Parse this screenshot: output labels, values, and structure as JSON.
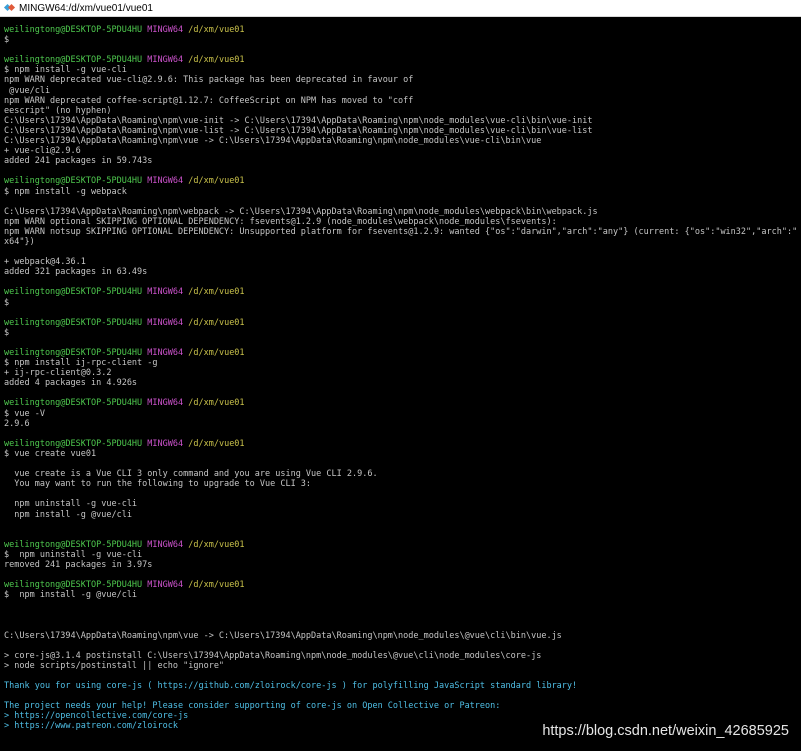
{
  "window": {
    "title": "MINGW64:/d/xm/vue01/vue01",
    "icon": "mingw-diamond-icon"
  },
  "terminal": {
    "colors": {
      "user": "#4ec94e",
      "host": "#cb52cb",
      "path": "#c8c04a",
      "text": "#c6c6c6",
      "link": "#4fbfe6"
    },
    "lines": [
      {
        "segs": [
          {
            "t": "weilingtong@DESKTOP-5PDU4HU",
            "c": "green"
          },
          {
            "t": " "
          },
          {
            "t": "MINGW64",
            "c": "magenta"
          },
          {
            "t": " "
          },
          {
            "t": "/d/xm/vue01",
            "c": "yellow"
          }
        ]
      },
      {
        "segs": [
          {
            "t": "$"
          }
        ]
      },
      {
        "segs": [
          {
            "t": ""
          }
        ]
      },
      {
        "segs": [
          {
            "t": "weilingtong@DESKTOP-5PDU4HU",
            "c": "green"
          },
          {
            "t": " "
          },
          {
            "t": "MINGW64",
            "c": "magenta"
          },
          {
            "t": " "
          },
          {
            "t": "/d/xm/vue01",
            "c": "yellow"
          }
        ]
      },
      {
        "segs": [
          {
            "t": "$ npm install -g vue-cli"
          }
        ]
      },
      {
        "segs": [
          {
            "t": "npm WARN deprecated vue-cli@2.9.6: This package has been deprecated in favour of"
          }
        ]
      },
      {
        "segs": [
          {
            "t": " @vue/cli"
          }
        ]
      },
      {
        "segs": [
          {
            "t": "npm WARN deprecated coffee-script@1.12.7: CoffeeScript on NPM has moved to \"coff"
          }
        ]
      },
      {
        "segs": [
          {
            "t": "eescript\" (no hyphen)"
          }
        ]
      },
      {
        "segs": [
          {
            "t": "C:\\Users\\17394\\AppData\\Roaming\\npm\\vue-init -> C:\\Users\\17394\\AppData\\Roaming\\npm\\node_modules\\vue-cli\\bin\\vue-init"
          }
        ]
      },
      {
        "segs": [
          {
            "t": "C:\\Users\\17394\\AppData\\Roaming\\npm\\vue-list -> C:\\Users\\17394\\AppData\\Roaming\\npm\\node_modules\\vue-cli\\bin\\vue-list"
          }
        ]
      },
      {
        "segs": [
          {
            "t": "C:\\Users\\17394\\AppData\\Roaming\\npm\\vue -> C:\\Users\\17394\\AppData\\Roaming\\npm\\node_modules\\vue-cli\\bin\\vue"
          }
        ]
      },
      {
        "segs": [
          {
            "t": "+ vue-cli@2.9.6"
          }
        ]
      },
      {
        "segs": [
          {
            "t": "added 241 packages in 59.743s"
          }
        ]
      },
      {
        "segs": [
          {
            "t": ""
          }
        ]
      },
      {
        "segs": [
          {
            "t": "weilingtong@DESKTOP-5PDU4HU",
            "c": "green"
          },
          {
            "t": " "
          },
          {
            "t": "MINGW64",
            "c": "magenta"
          },
          {
            "t": " "
          },
          {
            "t": "/d/xm/vue01",
            "c": "yellow"
          }
        ]
      },
      {
        "segs": [
          {
            "t": "$ npm install -g webpack"
          }
        ]
      },
      {
        "segs": [
          {
            "t": ""
          }
        ]
      },
      {
        "segs": [
          {
            "t": "C:\\Users\\17394\\AppData\\Roaming\\npm\\webpack -> C:\\Users\\17394\\AppData\\Roaming\\npm\\node_modules\\webpack\\bin\\webpack.js"
          }
        ]
      },
      {
        "segs": [
          {
            "t": "npm WARN optional SKIPPING OPTIONAL DEPENDENCY: fsevents@1.2.9 (node_modules\\webpack\\node_modules\\fsevents):"
          }
        ]
      },
      {
        "segs": [
          {
            "t": "npm WARN notsup SKIPPING OPTIONAL DEPENDENCY: Unsupported platform for fsevents@1.2.9: wanted {\"os\":\"darwin\",\"arch\":\"any\"} (current: {\"os\":\"win32\",\"arch\":\""
          }
        ]
      },
      {
        "segs": [
          {
            "t": "x64\"})"
          }
        ]
      },
      {
        "segs": [
          {
            "t": ""
          }
        ]
      },
      {
        "segs": [
          {
            "t": "+ webpack@4.36.1"
          }
        ]
      },
      {
        "segs": [
          {
            "t": "added 321 packages in 63.49s"
          }
        ]
      },
      {
        "segs": [
          {
            "t": ""
          }
        ]
      },
      {
        "segs": [
          {
            "t": "weilingtong@DESKTOP-5PDU4HU",
            "c": "green"
          },
          {
            "t": " "
          },
          {
            "t": "MINGW64",
            "c": "magenta"
          },
          {
            "t": " "
          },
          {
            "t": "/d/xm/vue01",
            "c": "yellow"
          }
        ]
      },
      {
        "segs": [
          {
            "t": "$"
          }
        ]
      },
      {
        "segs": [
          {
            "t": ""
          }
        ]
      },
      {
        "segs": [
          {
            "t": "weilingtong@DESKTOP-5PDU4HU",
            "c": "green"
          },
          {
            "t": " "
          },
          {
            "t": "MINGW64",
            "c": "magenta"
          },
          {
            "t": " "
          },
          {
            "t": "/d/xm/vue01",
            "c": "yellow"
          }
        ]
      },
      {
        "segs": [
          {
            "t": "$"
          }
        ]
      },
      {
        "segs": [
          {
            "t": ""
          }
        ]
      },
      {
        "segs": [
          {
            "t": "weilingtong@DESKTOP-5PDU4HU",
            "c": "green"
          },
          {
            "t": " "
          },
          {
            "t": "MINGW64",
            "c": "magenta"
          },
          {
            "t": " "
          },
          {
            "t": "/d/xm/vue01",
            "c": "yellow"
          }
        ]
      },
      {
        "segs": [
          {
            "t": "$ npm install ij-rpc-client -g"
          }
        ]
      },
      {
        "segs": [
          {
            "t": "+ ij-rpc-client@0.3.2"
          }
        ]
      },
      {
        "segs": [
          {
            "t": "added 4 packages in 4.926s"
          }
        ]
      },
      {
        "segs": [
          {
            "t": ""
          }
        ]
      },
      {
        "segs": [
          {
            "t": "weilingtong@DESKTOP-5PDU4HU",
            "c": "green"
          },
          {
            "t": " "
          },
          {
            "t": "MINGW64",
            "c": "magenta"
          },
          {
            "t": " "
          },
          {
            "t": "/d/xm/vue01",
            "c": "yellow"
          }
        ]
      },
      {
        "segs": [
          {
            "t": "$ vue -V"
          }
        ]
      },
      {
        "segs": [
          {
            "t": "2.9.6"
          }
        ]
      },
      {
        "segs": [
          {
            "t": ""
          }
        ]
      },
      {
        "segs": [
          {
            "t": "weilingtong@DESKTOP-5PDU4HU",
            "c": "green"
          },
          {
            "t": " "
          },
          {
            "t": "MINGW64",
            "c": "magenta"
          },
          {
            "t": " "
          },
          {
            "t": "/d/xm/vue01",
            "c": "yellow"
          }
        ]
      },
      {
        "segs": [
          {
            "t": "$ vue create vue01"
          }
        ]
      },
      {
        "segs": [
          {
            "t": ""
          }
        ]
      },
      {
        "segs": [
          {
            "t": "  vue create is a Vue CLI 3 only command and you are using Vue CLI 2.9.6."
          }
        ]
      },
      {
        "segs": [
          {
            "t": "  You may want to run the following to upgrade to Vue CLI 3:"
          }
        ]
      },
      {
        "segs": [
          {
            "t": ""
          }
        ]
      },
      {
        "segs": [
          {
            "t": "  npm uninstall -g vue-cli"
          }
        ]
      },
      {
        "segs": [
          {
            "t": "  npm install -g @vue/cli"
          }
        ]
      },
      {
        "segs": [
          {
            "t": ""
          }
        ]
      },
      {
        "segs": [
          {
            "t": ""
          }
        ]
      },
      {
        "segs": [
          {
            "t": "weilingtong@DESKTOP-5PDU4HU",
            "c": "green"
          },
          {
            "t": " "
          },
          {
            "t": "MINGW64",
            "c": "magenta"
          },
          {
            "t": " "
          },
          {
            "t": "/d/xm/vue01",
            "c": "yellow"
          }
        ]
      },
      {
        "segs": [
          {
            "t": "$  npm uninstall -g vue-cli"
          }
        ]
      },
      {
        "segs": [
          {
            "t": "removed 241 packages in 3.97s"
          }
        ]
      },
      {
        "segs": [
          {
            "t": ""
          }
        ]
      },
      {
        "segs": [
          {
            "t": "weilingtong@DESKTOP-5PDU4HU",
            "c": "green"
          },
          {
            "t": " "
          },
          {
            "t": "MINGW64",
            "c": "magenta"
          },
          {
            "t": " "
          },
          {
            "t": "/d/xm/vue01",
            "c": "yellow"
          }
        ]
      },
      {
        "segs": [
          {
            "t": "$  npm install -g @vue/cli"
          }
        ]
      },
      {
        "segs": [
          {
            "t": ""
          }
        ]
      },
      {
        "segs": [
          {
            "t": ""
          }
        ]
      },
      {
        "segs": [
          {
            "t": ""
          }
        ]
      },
      {
        "segs": [
          {
            "t": "C:\\Users\\17394\\AppData\\Roaming\\npm\\vue -> C:\\Users\\17394\\AppData\\Roaming\\npm\\node_modules\\@vue\\cli\\bin\\vue.js"
          }
        ]
      },
      {
        "segs": [
          {
            "t": ""
          }
        ]
      },
      {
        "segs": [
          {
            "t": "> core-js@3.1.4 postinstall C:\\Users\\17394\\AppData\\Roaming\\npm\\node_modules\\@vue\\cli\\node_modules\\core-js"
          }
        ]
      },
      {
        "segs": [
          {
            "t": "> node scripts/postinstall || echo \"ignore\""
          }
        ]
      },
      {
        "segs": [
          {
            "t": ""
          }
        ]
      },
      {
        "segs": [
          {
            "t": "Thank you for using core-js ( https://github.com/zloirock/core-js ) for polyfilling JavaScript standard library!",
            "c": "cyan"
          }
        ]
      },
      {
        "segs": [
          {
            "t": ""
          }
        ]
      },
      {
        "segs": [
          {
            "t": "The project needs your help! Please consider supporting of core-js on Open Collective or Patreon:",
            "c": "cyan"
          }
        ]
      },
      {
        "segs": [
          {
            "t": "> https://opencollective.com/core-js",
            "c": "cyan"
          }
        ]
      },
      {
        "segs": [
          {
            "t": "> https://www.patreon.com/zloirock",
            "c": "cyan"
          }
        ]
      }
    ]
  },
  "watermark": "https://blog.csdn.net/weixin_42685925"
}
